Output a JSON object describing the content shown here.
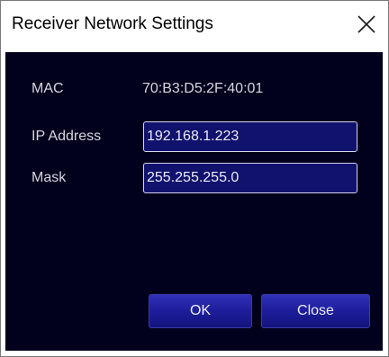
{
  "window": {
    "title": "Receiver Network Settings"
  },
  "fields": {
    "mac_label": "MAC",
    "mac_value": "70:B3:D5:2F:40:01",
    "ip_label": "IP Address",
    "ip_value": "192.168.1.223",
    "mask_label": "Mask",
    "mask_value": "255.255.255.0"
  },
  "buttons": {
    "ok_label": "OK",
    "close_label": "Close"
  },
  "icons": {
    "window_close": "close-icon"
  },
  "colors": {
    "panel_background": "#01011d",
    "field_background": "#11116e",
    "button_background": "#1c1c98"
  }
}
